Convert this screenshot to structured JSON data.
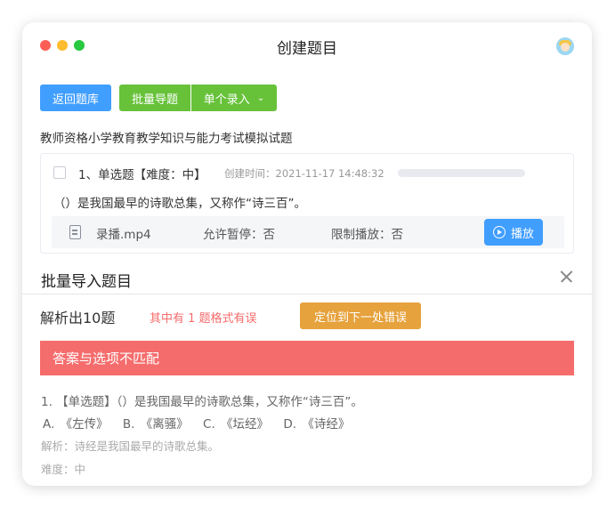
{
  "window": {
    "title": "创建题目"
  },
  "toolbar": {
    "back_label": "返回题库",
    "batch_label": "批量导题",
    "single_label": "单个录入"
  },
  "bank_title": "教师资格小学教育教学知识与能力考试模拟试题",
  "question": {
    "header": "1、单选题【难度：中】",
    "created": "创建时间：2021-11-17 14:48:32",
    "stem": "（）是我国最早的诗歌总集，又称作“诗三百”。",
    "media": {
      "file_name": "录播.mp4",
      "allow_pause": "允许暂停：否",
      "limit_play": "限制播放：否",
      "play_label": "播放"
    }
  },
  "import_panel": {
    "title": "批量导入题目",
    "parse_count": "解析出10题",
    "error_summary": "其中有 1 题格式有误",
    "locate_label": "定位到下一处错误",
    "error_banner": "答案与选项不匹配",
    "preview": {
      "question": "1. 【单选题】（）是我国最早的诗歌总集，又称作“诗三百”。",
      "options": [
        "A. 《左传》",
        "B. 《离骚》",
        "C. 《坛经》",
        "D. 《诗经》"
      ],
      "analysis": "解析：诗经是我国最早的诗歌总集。",
      "difficulty": "难度：中"
    }
  },
  "colors": {
    "primary": "#409eff",
    "success": "#67c23a",
    "warning": "#e6a23c",
    "danger": "#f56c6c"
  }
}
